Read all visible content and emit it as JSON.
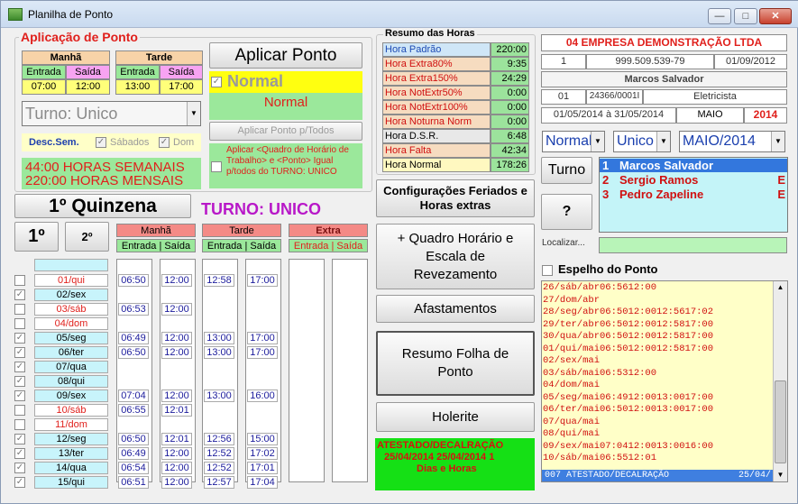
{
  "window": {
    "title": "Planilha de Ponto",
    "btn_min": "—",
    "btn_max": "□",
    "btn_close": "✕"
  },
  "aplicacao": {
    "group_label": "Aplicação de Ponto",
    "manha": "Manhã",
    "tarde": "Tarde",
    "entrada": "Entrada",
    "saida": "Saída",
    "m_in": "07:00",
    "m_out": "12:00",
    "t_in": "13:00",
    "t_out": "17:00",
    "aplicar_btn": "Aplicar Ponto",
    "normal_chk": "Normal",
    "normal_lbl": "Normal",
    "turno_value": "Turno: Unico",
    "aplicar_todos": "Aplicar Ponto p/Todos",
    "desc_sem": "Desc.Sem.",
    "sabados": "Sábados",
    "dom": "Dom",
    "horas_sem": "44:00 HORAS SEMANAIS",
    "horas_mes": "220:00 HORAS MENSAIS",
    "aplicar_quadro": "Aplicar <Quadro de Horário de Trabalho> e <Ponto> Igual p/todos do TURNO: UNICO"
  },
  "resumo": {
    "title": "Resumo das Horas",
    "rows": [
      {
        "label": "Hora Padrão",
        "value": "220:00",
        "lc": "#1e4bb4",
        "bg": "#cfe6f7",
        "vbg": "#9ce39c"
      },
      {
        "label": "Hora Extra80%",
        "value": "9:35",
        "lc": "#d01010",
        "bg": "#f6dcc0",
        "vbg": "#9ce39c"
      },
      {
        "label": "Hora Extra150%",
        "value": "24:29",
        "lc": "#d01010",
        "bg": "#f6dcc0",
        "vbg": "#9ce39c"
      },
      {
        "label": "Hora NotExtr50%",
        "value": "0:00",
        "lc": "#d01010",
        "bg": "#f6dcc0",
        "vbg": "#9ce39c"
      },
      {
        "label": "Hora NotExtr100%",
        "value": "0:00",
        "lc": "#d01010",
        "bg": "#f6dcc0",
        "vbg": "#9ce39c"
      },
      {
        "label": "Hora Noturna Norm",
        "value": "0:00",
        "lc": "#d01010",
        "bg": "#f6dcc0",
        "vbg": "#9ce39c"
      },
      {
        "label": "Hora D.S.R.",
        "value": "6:48",
        "lc": "#000000",
        "bg": "#e8e8e8",
        "vbg": "#9ce39c"
      },
      {
        "label": "Hora Falta",
        "value": "42:34",
        "lc": "#d01010",
        "bg": "#f6dcc0",
        "vbg": "#9ce39c"
      },
      {
        "label": "Hora Normal",
        "value": "178:26",
        "lc": "#000000",
        "bg": "#fff8c0",
        "vbg": "#9ce39c"
      }
    ]
  },
  "empresa": {
    "name": "04 EMPRESA DEMONSTRAÇÃO LTDA",
    "num": "1",
    "cnpj": "999.509.539-79",
    "date": "01/09/2012",
    "func_name": "Marcos Salvador",
    "code": "01",
    "reg": "24366/0001I",
    "cargo": "Eletricista",
    "periodo": "01/05/2014 à 31/05/2014",
    "mes": "MAIO",
    "ano": "2014"
  },
  "filters": {
    "tipo": "Normal",
    "turno": "Unico",
    "mes": "MAIO/2014"
  },
  "turno_btn": "Turno",
  "help_btn": "?",
  "localizar": "Localizar...",
  "employees": [
    {
      "n": "1",
      "name": "Marcos Salvador",
      "extra": ""
    },
    {
      "n": "2",
      "name": "Sergio Ramos",
      "extra": "E"
    },
    {
      "n": "3",
      "name": "Pedro Zapeline",
      "extra": "E"
    }
  ],
  "quinzena": {
    "title": "1º Quinzena",
    "btn1": "1º",
    "btn2": "2º",
    "turno_label": "TURNO: UNICO"
  },
  "grid_headers": {
    "manha": "Manhã",
    "tarde": "Tarde",
    "extra": "Extra",
    "es": "Entrada | Saída"
  },
  "days": [
    {
      "d": "01/qui",
      "red": true,
      "chk": false,
      "m1": "06:50",
      "m2": "12:00",
      "t1": "12:58",
      "t2": "17:00"
    },
    {
      "d": "02/sex",
      "red": false,
      "chk": true,
      "m1": "",
      "m2": "",
      "t1": "",
      "t2": ""
    },
    {
      "d": "03/sáb",
      "red": true,
      "chk": false,
      "m1": "06:53",
      "m2": "12:00",
      "t1": "",
      "t2": ""
    },
    {
      "d": "04/dom",
      "red": true,
      "chk": false,
      "m1": "",
      "m2": "",
      "t1": "",
      "t2": ""
    },
    {
      "d": "05/seg",
      "red": false,
      "chk": true,
      "m1": "06:49",
      "m2": "12:00",
      "t1": "13:00",
      "t2": "17:00"
    },
    {
      "d": "06/ter",
      "red": false,
      "chk": true,
      "m1": "06:50",
      "m2": "12:00",
      "t1": "13:00",
      "t2": "17:00"
    },
    {
      "d": "07/qua",
      "red": false,
      "chk": true,
      "m1": "",
      "m2": "",
      "t1": "",
      "t2": ""
    },
    {
      "d": "08/qui",
      "red": false,
      "chk": true,
      "m1": "",
      "m2": "",
      "t1": "",
      "t2": ""
    },
    {
      "d": "09/sex",
      "red": false,
      "chk": true,
      "m1": "07:04",
      "m2": "12:00",
      "t1": "13:00",
      "t2": "16:00"
    },
    {
      "d": "10/sáb",
      "red": true,
      "chk": false,
      "m1": "06:55",
      "m2": "12:01",
      "t1": "",
      "t2": ""
    },
    {
      "d": "11/dom",
      "red": true,
      "chk": false,
      "m1": "",
      "m2": "",
      "t1": "",
      "t2": ""
    },
    {
      "d": "12/seg",
      "red": false,
      "chk": true,
      "m1": "06:50",
      "m2": "12:01",
      "t1": "12:56",
      "t2": "15:00"
    },
    {
      "d": "13/ter",
      "red": false,
      "chk": true,
      "m1": "06:49",
      "m2": "12:00",
      "t1": "12:52",
      "t2": "17:02"
    },
    {
      "d": "14/qua",
      "red": false,
      "chk": true,
      "m1": "06:54",
      "m2": "12:00",
      "t1": "12:52",
      "t2": "17:01"
    },
    {
      "d": "15/qui",
      "red": false,
      "chk": true,
      "m1": "06:51",
      "m2": "12:00",
      "t1": "12:57",
      "t2": "17:04"
    }
  ],
  "mid_buttons": {
    "config": "Configurações Feriados e Horas extras",
    "quadro": "+ Quadro Horário e Escala de Revezamento",
    "afast": "Afastamentos",
    "resumo": "Resumo Folha de Ponto",
    "holerite": "Holerite"
  },
  "atestado": {
    "l1": "ATESTADO/DECALRAÇÃO",
    "l2": "25/04/2014  25/04/2014  1",
    "l3": "Dias e    Horas"
  },
  "espelho": {
    "title": "Espelho do Ponto",
    "lines": [
      "26/sáb/abr06:5612:00",
      "27/dom/abr",
      "28/seg/abr06:5012:0012:5617:02",
      "29/ter/abr06:5012:0012:5817:00",
      "30/qua/abr06:5012:0012:5817:00",
      "01/qui/mai06:5012:0012:5817:00",
      "02/sex/mai",
      "03/sáb/mai06:5312:00",
      "04/dom/mai",
      "05/seg/mai06:4912:0013:0017:00",
      "06/ter/mai06:5012:0013:0017:00",
      "07/qua/mai",
      "08/qui/mai",
      "09/sex/mai07:0412:0013:0016:00",
      "10/sáb/mai06:5512:01"
    ],
    "footer_left": "007 ATESTADO/DECALRAÇÃO",
    "footer_right": "25/04/"
  }
}
